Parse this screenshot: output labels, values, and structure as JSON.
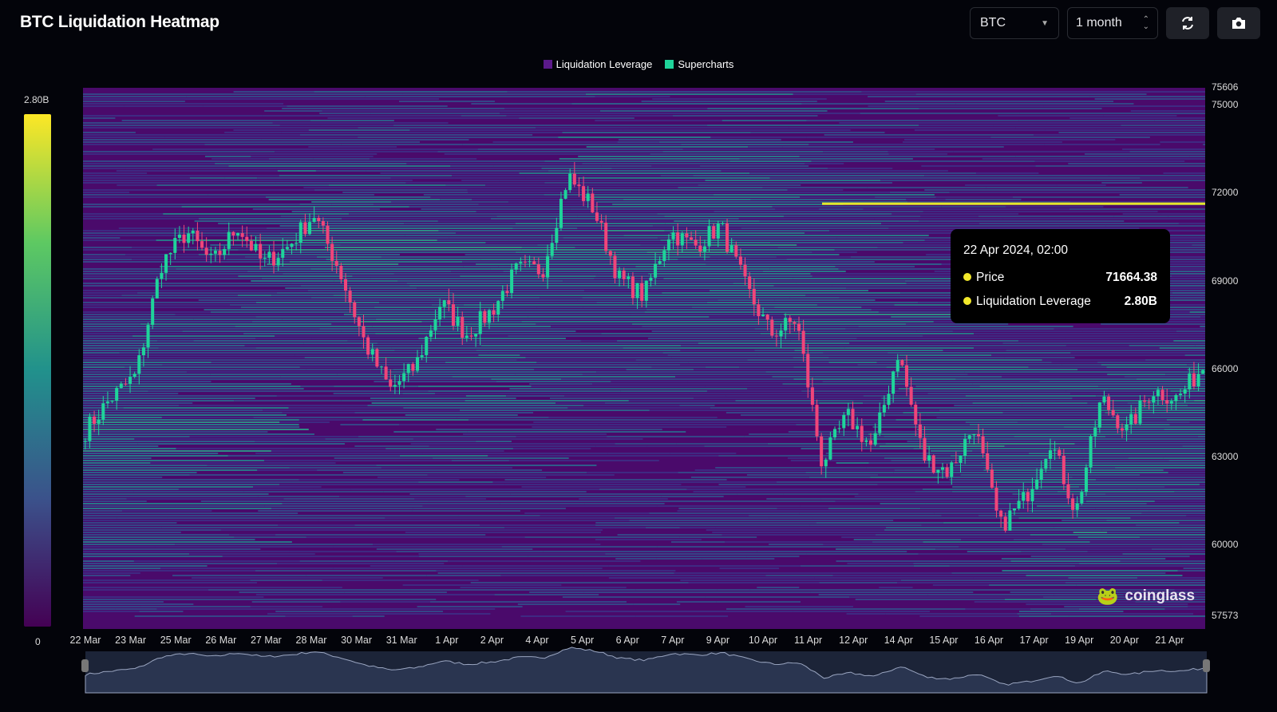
{
  "header": {
    "title": "BTC Liquidation Heatmap",
    "symbol": "BTC",
    "range": "1 month",
    "refresh_icon": "refresh-icon",
    "camera_icon": "camera-icon"
  },
  "legend": [
    {
      "label": "Liquidation Leverage",
      "color": "#5b1a8a"
    },
    {
      "label": "Supercharts",
      "color": "#1fd49a"
    }
  ],
  "colorbar": {
    "max_label": "2.80B",
    "min_label": "0"
  },
  "tooltip": {
    "date": "22 Apr 2024, 02:00",
    "price_label": "Price",
    "price_value": "71664.38",
    "lev_label": "Liquidation Leverage",
    "lev_value": "2.80B",
    "dot_color": "#f2e82a"
  },
  "watermark": "coinglass",
  "chart_data": {
    "type": "heatmap",
    "title": "BTC Liquidation Heatmap",
    "y_ticks": [
      "75606",
      "75000",
      "72000",
      "69000",
      "66000",
      "63000",
      "60000",
      "57573"
    ],
    "y_tick_values": [
      75606,
      75000,
      72000,
      69000,
      66000,
      63000,
      60000,
      57573
    ],
    "ylim": [
      57573,
      75606
    ],
    "x_ticks": [
      "22 Mar",
      "23 Mar",
      "25 Mar",
      "26 Mar",
      "27 Mar",
      "28 Mar",
      "30 Mar",
      "31 Mar",
      "1 Apr",
      "2 Apr",
      "4 Apr",
      "5 Apr",
      "6 Apr",
      "7 Apr",
      "9 Apr",
      "10 Apr",
      "11 Apr",
      "12 Apr",
      "14 Apr",
      "15 Apr",
      "16 Apr",
      "17 Apr",
      "19 Apr",
      "20 Apr",
      "21 Apr"
    ],
    "price_path": [
      63900,
      65000,
      65800,
      69600,
      70700,
      69600,
      70900,
      69600,
      70200,
      71300,
      69400,
      66900,
      65300,
      66100,
      68300,
      67200,
      68000,
      69400,
      69400,
      72600,
      71500,
      69100,
      68500,
      70700,
      70200,
      70900,
      68800,
      67200,
      67700,
      62800,
      64400,
      63300,
      66600,
      63000,
      62500,
      64100,
      60600,
      61600,
      63600,
      61100,
      65000,
      63900,
      65300,
      65000,
      66100
    ],
    "highlight_level": 71664.38,
    "max_leverage": "2.80B"
  }
}
